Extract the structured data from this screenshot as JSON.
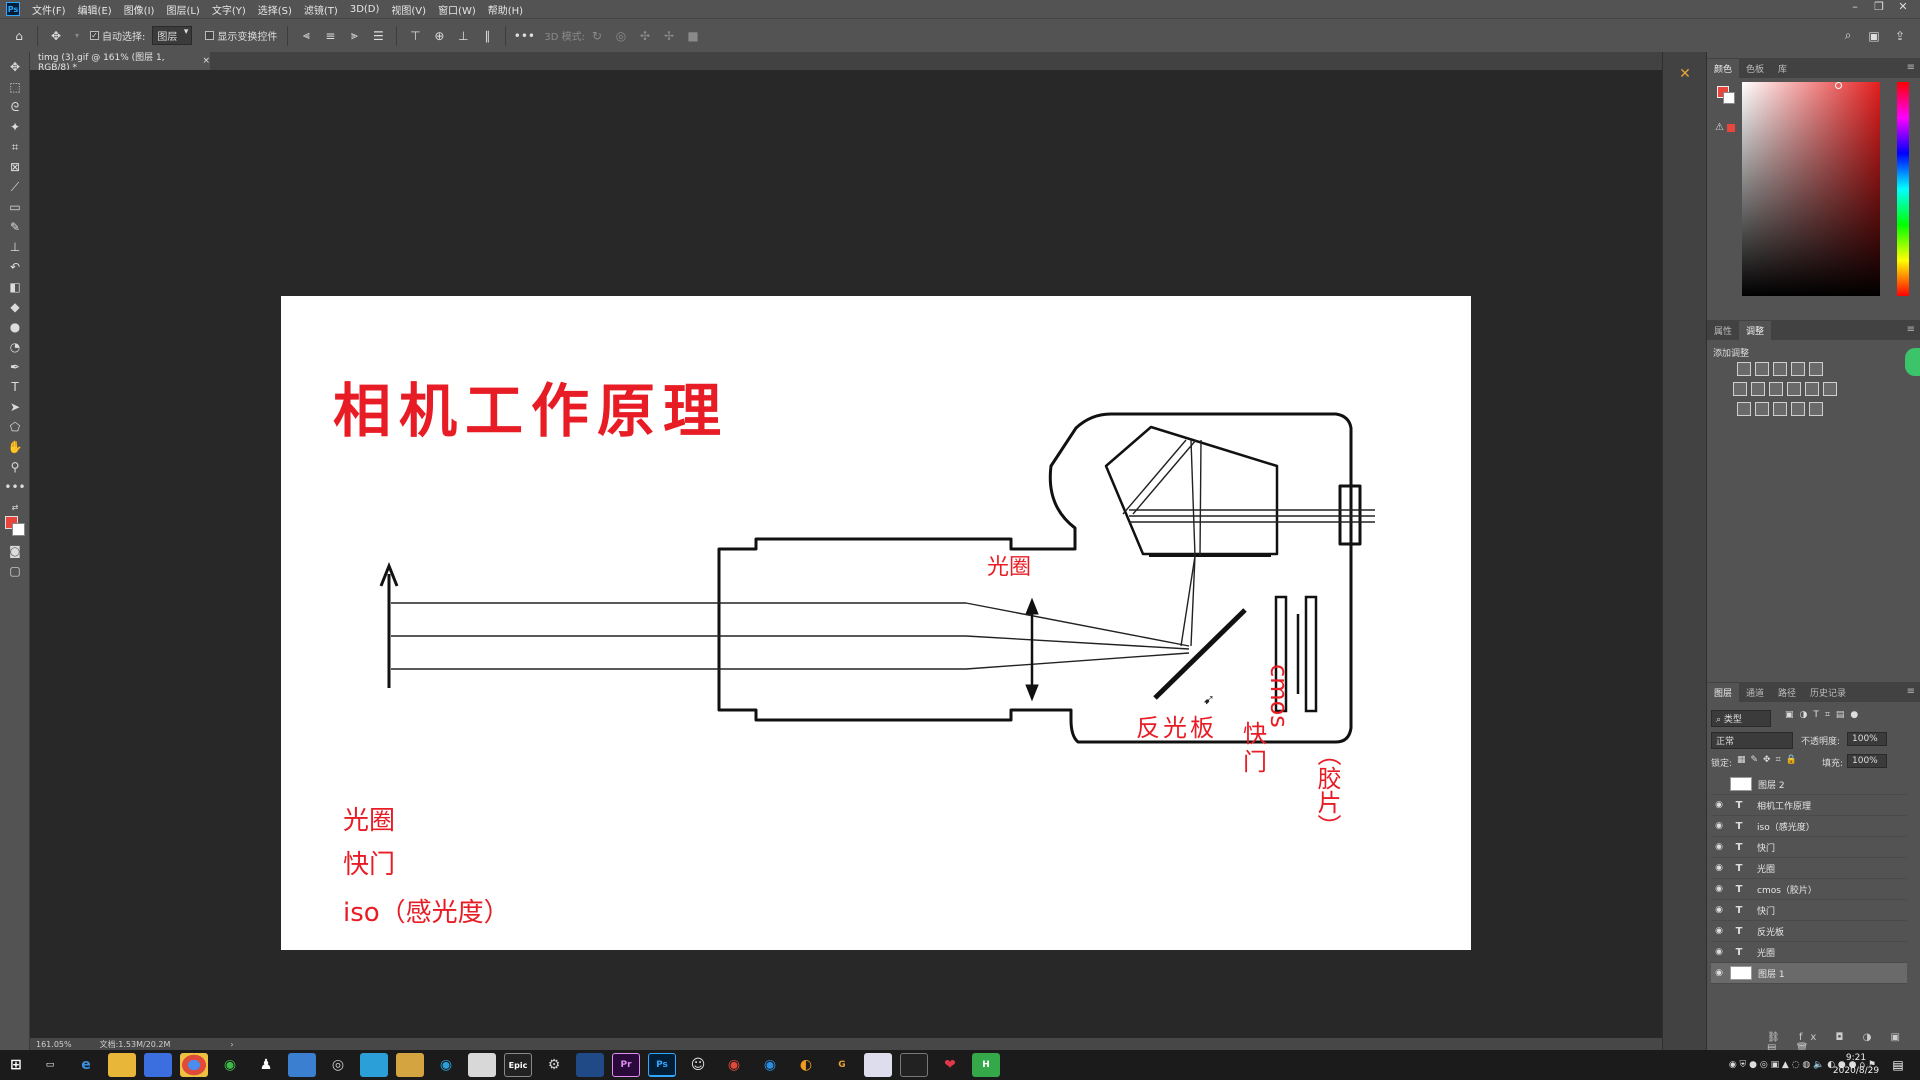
{
  "app": {
    "logo": "Ps"
  },
  "menu": [
    "文件(F)",
    "编辑(E)",
    "图像(I)",
    "图层(L)",
    "文字(Y)",
    "选择(S)",
    "滤镜(T)",
    "3D(D)",
    "视图(V)",
    "窗口(W)",
    "帮助(H)"
  ],
  "options": {
    "auto_select_label": "自动选择:",
    "auto_select_value": "图层",
    "show_transform_label": "显示变换控件",
    "mode3d_label": "3D 模式:"
  },
  "document": {
    "tab_title": "timg (3).gif @ 161% (图层 1, RGB/8) *",
    "close": "×"
  },
  "status": {
    "zoom": "161.05%",
    "doc_size": "文档:1.53M/20.2M",
    "arrow": "›"
  },
  "artwork": {
    "title": "相机工作原理",
    "label_aperture": "光圈",
    "label_mirror": "反光板",
    "label_shutter_1": "快",
    "label_shutter_2": "门",
    "label_cmos": "cmos",
    "label_film": "（胶片）",
    "list_aperture": "光圈",
    "list_shutter": "快门",
    "list_iso": "iso（感光度）",
    "colors": {
      "red": "#e81c25",
      "line": "#111111"
    }
  },
  "panels": {
    "color_tabs": [
      "颜色",
      "色板",
      "库"
    ],
    "props_tabs": [
      "属性",
      "调整"
    ],
    "adjust_title": "添加调整",
    "layers_tabs": [
      "图层",
      "通道",
      "路径",
      "历史记录"
    ],
    "filter_kind": "类型",
    "blend_mode": "正常",
    "opacity_label": "不透明度:",
    "opacity_value": "100%",
    "lock_label": "锁定:",
    "fill_label": "填充:",
    "fill_value": "100%",
    "layers": [
      {
        "name": "图层 2",
        "type": "image",
        "visible": false
      },
      {
        "name": "相机工作原理",
        "type": "text",
        "visible": true
      },
      {
        "name": "iso（感光度）",
        "type": "text",
        "visible": true
      },
      {
        "name": "快门",
        "type": "text",
        "visible": true
      },
      {
        "name": "光圈",
        "type": "text",
        "visible": true
      },
      {
        "name": "cmos（胶片）",
        "type": "text",
        "visible": true
      },
      {
        "name": "快门",
        "type": "text",
        "visible": true
      },
      {
        "name": "反光板",
        "type": "text",
        "visible": true
      },
      {
        "name": "光圈",
        "type": "text",
        "visible": true
      },
      {
        "name": "图层 1",
        "type": "image",
        "visible": true,
        "selected": true
      }
    ],
    "layer_type_glyph": "T"
  },
  "taskbar": {
    "apps": [
      "Epic",
      "Pr",
      "Ps",
      "G",
      "H"
    ],
    "time": "9:21",
    "date": "2020/8/29"
  }
}
